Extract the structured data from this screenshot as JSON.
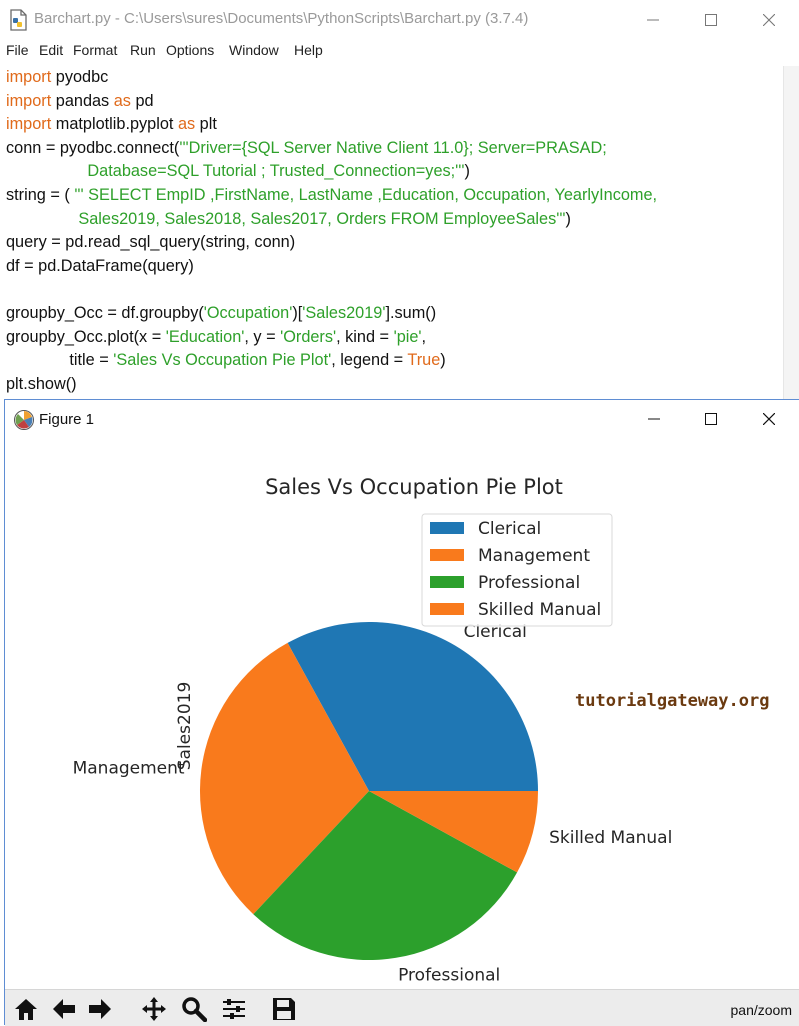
{
  "idle": {
    "title": "Barchart.py - C:\\Users\\sures\\Documents\\PythonScripts\\Barchart.py (3.7.4)",
    "menu": [
      "File",
      "Edit",
      "Format",
      "Run",
      "Options",
      "Window",
      "Help"
    ],
    "code_lines": [
      [
        {
          "t": "import",
          "c": "kw"
        },
        {
          "t": " pyodbc",
          "c": ""
        }
      ],
      [
        {
          "t": "import",
          "c": "kw"
        },
        {
          "t": " pandas ",
          "c": ""
        },
        {
          "t": "as",
          "c": "kw"
        },
        {
          "t": " pd",
          "c": ""
        }
      ],
      [
        {
          "t": "import",
          "c": "kw"
        },
        {
          "t": " matplotlib.pyplot ",
          "c": ""
        },
        {
          "t": "as",
          "c": "kw"
        },
        {
          "t": " plt",
          "c": ""
        }
      ],
      [
        {
          "t": "conn = pyodbc.connect(",
          "c": ""
        },
        {
          "t": "'''Driver={SQL Server Native Client 11.0}; Server=PRASAD;",
          "c": "st"
        }
      ],
      [
        {
          "t": "                  Database=SQL Tutorial ; Trusted_Connection=yes;'''",
          "c": "st"
        },
        {
          "t": ")",
          "c": ""
        }
      ],
      [
        {
          "t": "string = ( ",
          "c": ""
        },
        {
          "t": "''' SELECT EmpID ,FirstName, LastName ,Education, Occupation, YearlyIncome,",
          "c": "st"
        }
      ],
      [
        {
          "t": "                Sales2019, Sales2018, Sales2017, Orders FROM EmployeeSales'''",
          "c": "st"
        },
        {
          "t": ")",
          "c": ""
        }
      ],
      [
        {
          "t": "query = pd.read_sql_query(string, conn)",
          "c": ""
        }
      ],
      [
        {
          "t": "df = pd.DataFrame(query)",
          "c": ""
        }
      ],
      [
        {
          "t": "",
          "c": ""
        }
      ],
      [
        {
          "t": "groupby_Occ = df.groupby(",
          "c": ""
        },
        {
          "t": "'Occupation'",
          "c": "st"
        },
        {
          "t": ")[",
          "c": ""
        },
        {
          "t": "'Sales2019'",
          "c": "st"
        },
        {
          "t": "].sum()",
          "c": ""
        }
      ],
      [
        {
          "t": "groupby_Occ.plot(x = ",
          "c": ""
        },
        {
          "t": "'Education'",
          "c": "st"
        },
        {
          "t": ", y = ",
          "c": ""
        },
        {
          "t": "'Orders'",
          "c": "st"
        },
        {
          "t": ", kind = ",
          "c": ""
        },
        {
          "t": "'pie'",
          "c": "st"
        },
        {
          "t": ",",
          "c": ""
        }
      ],
      [
        {
          "t": "              title = ",
          "c": ""
        },
        {
          "t": "'Sales Vs Occupation Pie Plot'",
          "c": "st"
        },
        {
          "t": ", legend = ",
          "c": ""
        },
        {
          "t": "True",
          "c": "kw"
        },
        {
          "t": ")",
          "c": ""
        }
      ],
      [
        {
          "t": "plt.show()",
          "c": ""
        }
      ]
    ]
  },
  "figure": {
    "title": "Figure 1",
    "status": "pan/zoom",
    "watermark": "tutorialgateway.org"
  },
  "toolbar": {
    "icons": [
      "home-icon",
      "back-icon",
      "forward-icon",
      "pan-icon",
      "zoom-icon",
      "configure-subplots-icon",
      "save-icon"
    ]
  },
  "chart_data": {
    "type": "pie",
    "title": "Sales Vs Occupation Pie Plot",
    "ylabel": "Sales2019",
    "categories": [
      "Clerical",
      "Management",
      "Professional",
      "Skilled Manual"
    ],
    "values": [
      33,
      30,
      29,
      8
    ],
    "colors": [
      "#1f77b4",
      "#f97a1c",
      "#2ca02c",
      "#f97a1c"
    ],
    "start_angle_deg": 0,
    "direction": "counterclockwise",
    "legend": [
      "Clerical",
      "Management",
      "Professional",
      "Skilled Manual"
    ],
    "legend_position": "upper-right"
  }
}
